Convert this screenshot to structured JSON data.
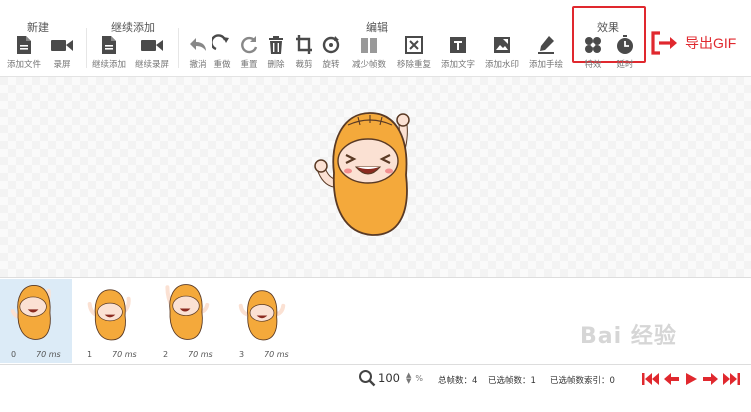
{
  "toolbar": {
    "groups": {
      "new": "新建",
      "continue_add": "继续添加",
      "edit": "编辑",
      "effects": "效果"
    },
    "items": {
      "add_file": "添加文件",
      "record": "录屏",
      "continue_add": "继续添加",
      "continue_record": "继续录屏",
      "undo": "撤消",
      "redo": "重做",
      "reset": "重置",
      "delete": "删除",
      "crop": "裁剪",
      "rotate": "旋转",
      "reduce_frames": "减少帧数",
      "remove_duplicate": "移除重复",
      "add_text": "添加文字",
      "add_watermark": "添加水印",
      "add_handwriting": "添加手绘",
      "special_effect": "特效",
      "delay": "延时"
    },
    "export_label": "导出GIF"
  },
  "frames": [
    {
      "index": "0",
      "ms": "70 ms"
    },
    {
      "index": "1",
      "ms": "70 ms"
    },
    {
      "index": "2",
      "ms": "70 ms"
    },
    {
      "index": "3",
      "ms": "70 ms"
    }
  ],
  "status": {
    "zoom_value": "100",
    "zoom_unit": "%",
    "total_frames": "总帧数：4",
    "selected_frames": "已选帧数：1",
    "selected_index": "已选帧数索引：0"
  },
  "colors": {
    "accent": "#e0282e",
    "icon": "#4a4a4a",
    "selected_frame": "#dcebf7",
    "character": "#f4a93b"
  }
}
